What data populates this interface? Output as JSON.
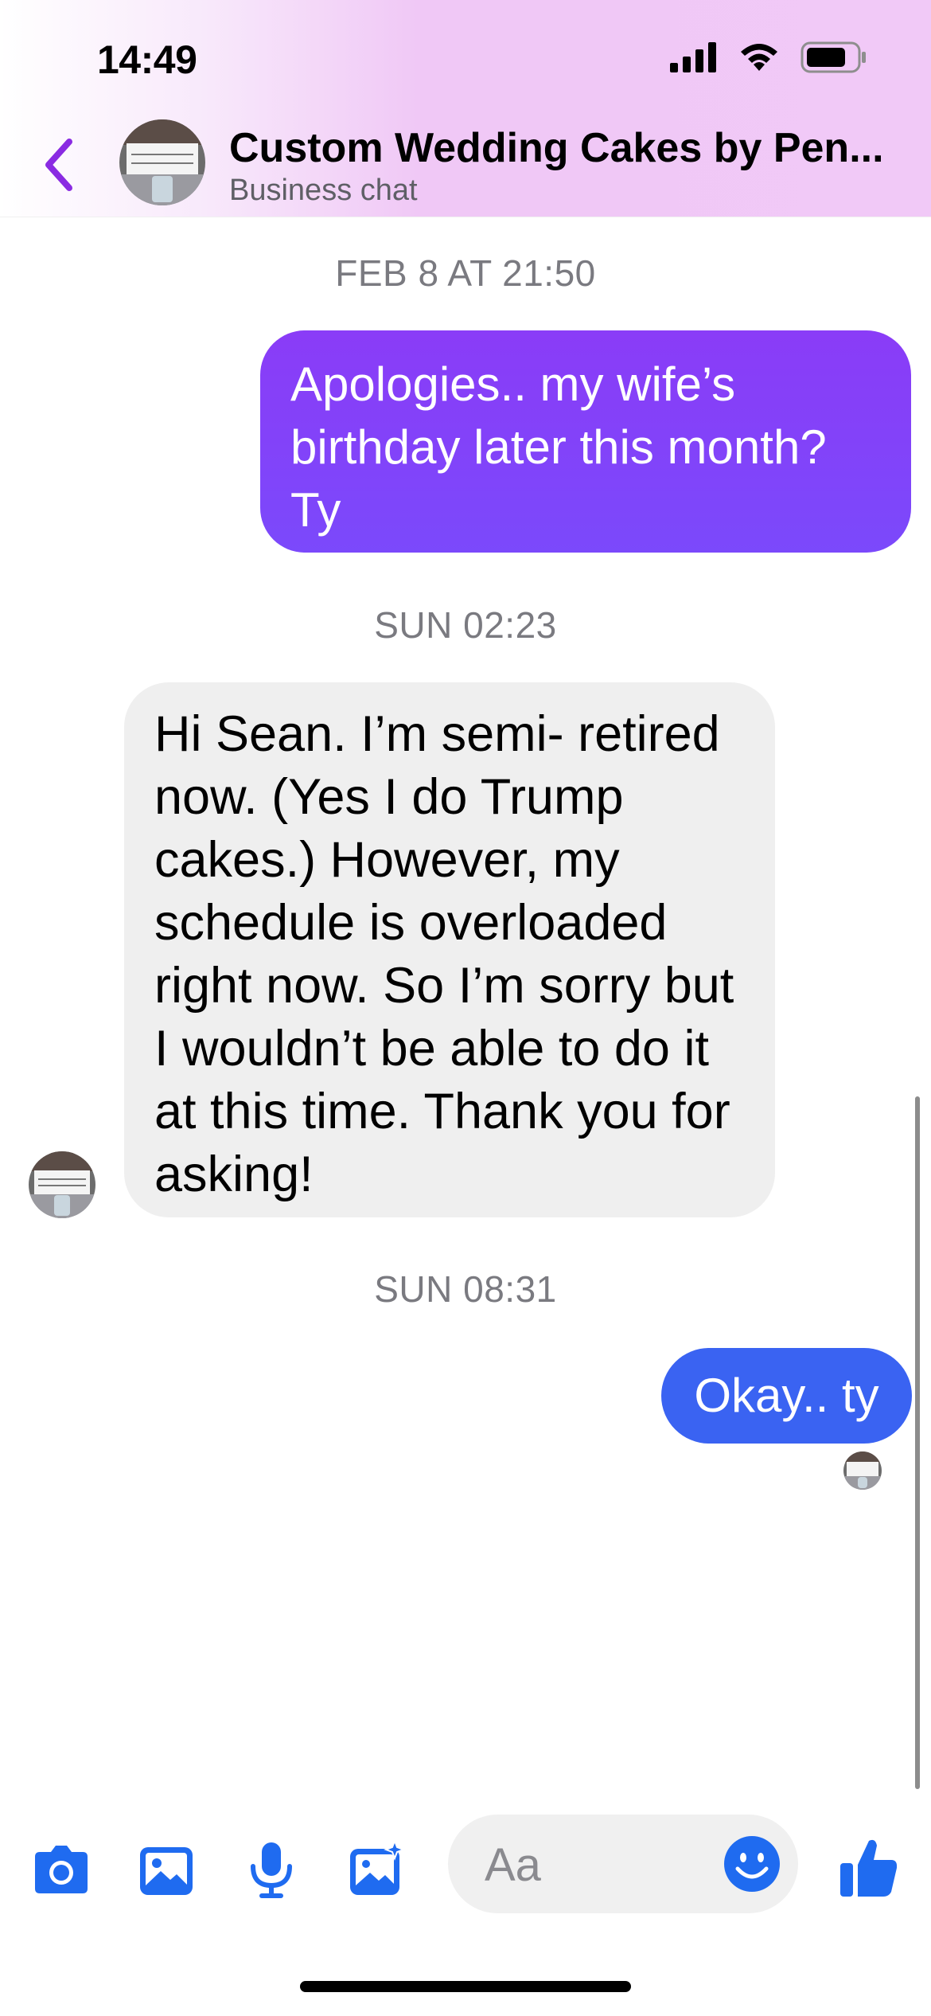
{
  "status_bar": {
    "time": "14:49"
  },
  "header": {
    "title": "Custom Wedding Cakes by Pen...",
    "subtitle": "Business chat"
  },
  "messages": [
    {
      "type": "timestamp",
      "text": "FEB 8 AT 21:50"
    },
    {
      "type": "outgoing",
      "lines": [
        "Apologies.. my wife’s",
        "birthday later this month?",
        "Ty"
      ]
    },
    {
      "type": "timestamp",
      "text": "SUN 02:23"
    },
    {
      "type": "incoming",
      "lines": [
        "Hi Sean. I’m semi- retired",
        "now. (Yes I do Trump",
        "cakes.) However, my",
        "schedule is overloaded",
        "right now. So I’m sorry but",
        "I wouldn’t be able to do it",
        "at this time.  Thank you for",
        "asking!"
      ]
    },
    {
      "type": "timestamp",
      "text": "SUN 08:31"
    },
    {
      "type": "outgoing",
      "lines": [
        "Okay.. ty"
      ]
    }
  ],
  "composer": {
    "placeholder": "Aa",
    "icons": [
      "camera-icon",
      "gallery-icon",
      "microphone-icon",
      "sticker-photo-icon",
      "emoji-icon",
      "thumbs-up-icon"
    ]
  },
  "colors": {
    "accent_purple": "#8a3cf7",
    "outgoing_blue": "#3a63f2",
    "composer_blue": "#1f6bf0",
    "incoming_gray": "#efefef"
  }
}
